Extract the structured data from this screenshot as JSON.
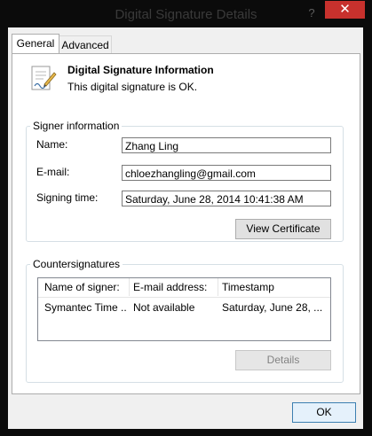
{
  "window": {
    "title": "Digital Signature Details",
    "help_label": "?",
    "close_label": "✕"
  },
  "tabs": [
    {
      "label": "General",
      "active": true
    },
    {
      "label": "Advanced",
      "active": false
    }
  ],
  "header": {
    "icon": "signed-document-icon",
    "title": "Digital Signature Information",
    "status": "This digital signature is OK."
  },
  "signer": {
    "group_label": "Signer information",
    "name_label": "Name:",
    "name_value": "Zhang Ling",
    "email_label": "E-mail:",
    "email_value": "chloezhangling@gmail.com",
    "time_label": "Signing time:",
    "time_value": "Saturday, June 28, 2014 10:41:38 AM",
    "view_certificate_label": "View Certificate"
  },
  "countersignatures": {
    "group_label": "Countersignatures",
    "columns": [
      "Name of signer:",
      "E-mail address:",
      "Timestamp"
    ],
    "rows": [
      [
        "Symantec Time ...",
        "Not available",
        "Saturday, June 28, ..."
      ]
    ],
    "details_label": "Details"
  },
  "footer": {
    "ok_label": "OK"
  },
  "colors": {
    "close_button": "#c7312d",
    "frame": "#0b0b0b",
    "dialog_background": "#f0f0f0"
  }
}
